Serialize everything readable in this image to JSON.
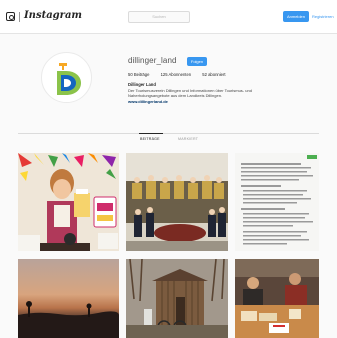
{
  "topbar": {
    "logo_text": "Instagram",
    "search_placeholder": "Suchen",
    "login_label": "Anmelden",
    "register_label": "Registrieren"
  },
  "profile": {
    "username": "dillinger_land",
    "follow_label": "Folgen",
    "stats": {
      "posts": "50 Beiträge",
      "followers": "125 Abonnenten",
      "following": "52 abonniert"
    },
    "bio_name": "Dillinger Land",
    "bio_lines": [
      "Der Tourismusverein Dillingen und Informationen über Tourismus- und",
      "Naherholungsangebote aus dem Landkreis Dillingen."
    ],
    "website": "www.dillingerland.de"
  },
  "tabs": {
    "posts": "Beiträge",
    "tagged": "Markiert"
  },
  "icons": {
    "camera": "camera-icon",
    "avatar_logo": "dillinger-land-logo"
  },
  "colors": {
    "accent_blue": "#3897f0",
    "logo_orange": "#f7a823",
    "logo_green": "#8bc34a",
    "logo_blue": "#1565c0"
  }
}
